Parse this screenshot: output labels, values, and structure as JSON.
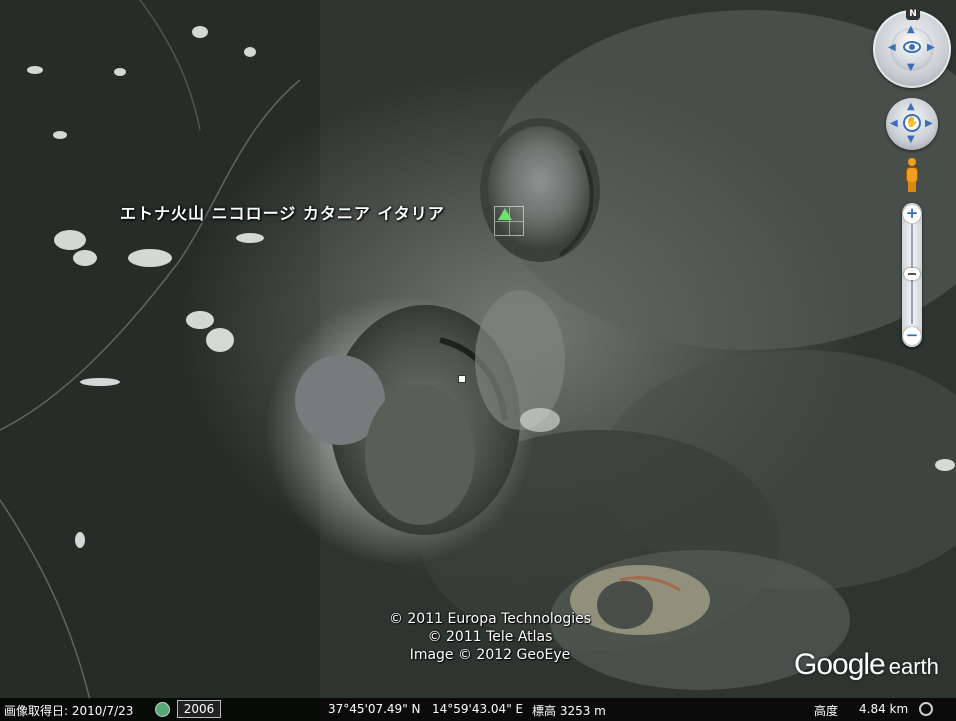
{
  "placemark": {
    "label": "エトナ火山 ニコロージ カタニア イタリア"
  },
  "copyright": {
    "line1": "© 2011 Europa Technologies",
    "line2": "© 2011 Tele Atlas",
    "line3": "Image © 2012 GeoEye"
  },
  "logo": {
    "google": "Google",
    "earth": "earth"
  },
  "navigation": {
    "north_label": "N"
  },
  "status_bar": {
    "imagery_date_label": "画像取得日: 2010/7/23",
    "historical_year": "2006",
    "latitude": "37°45'07.49\" N",
    "longitude": "14°59'43.04\" E",
    "elevation": "標高  3253 m",
    "eye_alt_label": "高度",
    "eye_alt_value": "4.84 km"
  },
  "icons": [
    "eye-icon",
    "hand-icon",
    "pegman-icon",
    "zoom-in-icon",
    "zoom-out-icon",
    "clock-icon",
    "streaming-icon"
  ]
}
